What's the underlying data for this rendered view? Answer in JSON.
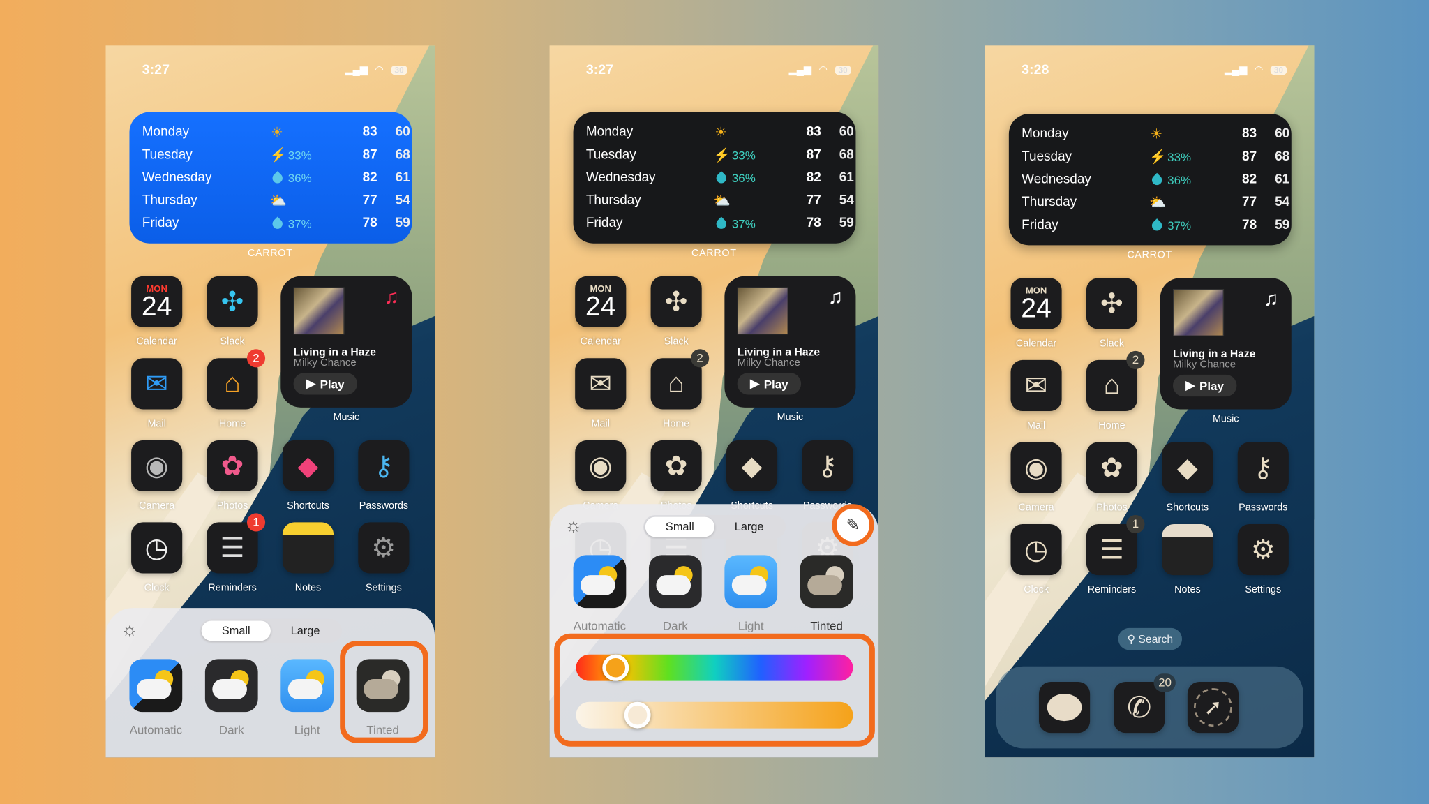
{
  "weather": {
    "source_label": "CARROT",
    "days": [
      {
        "day": "Monday",
        "icon": "sun-icon",
        "precip": "",
        "high": "83",
        "low": "60"
      },
      {
        "day": "Tuesday",
        "icon": "lightning-icon",
        "precip": "33%",
        "high": "87",
        "low": "68"
      },
      {
        "day": "Wednesday",
        "icon": "raindrop-icon",
        "precip": "36%",
        "high": "82",
        "low": "61"
      },
      {
        "day": "Thursday",
        "icon": "partly-cloudy-icon",
        "precip": "",
        "high": "77",
        "low": "54"
      },
      {
        "day": "Friday",
        "icon": "raindrop-icon",
        "precip": "37%",
        "high": "78",
        "low": "59"
      }
    ]
  },
  "calendar": {
    "weekday": "MON",
    "date": "24"
  },
  "music": {
    "song": "Living in a Haze",
    "artist": "Milky Chance",
    "play_label": "Play",
    "widget_label": "Music"
  },
  "apps": [
    {
      "name": "Calendar",
      "icon": "calendar-icon"
    },
    {
      "name": "Slack",
      "icon": "slack-icon"
    },
    {
      "name": "Mail",
      "icon": "mail-icon"
    },
    {
      "name": "Home",
      "icon": "home-icon",
      "badge": "2"
    },
    {
      "name": "Camera",
      "icon": "camera-icon"
    },
    {
      "name": "Photos",
      "icon": "photos-icon"
    },
    {
      "name": "Shortcuts",
      "icon": "shortcuts-icon"
    },
    {
      "name": "Passwords",
      "icon": "key-icon"
    },
    {
      "name": "Clock",
      "icon": "clock-icon"
    },
    {
      "name": "Reminders",
      "icon": "reminders-icon",
      "badge": "1"
    },
    {
      "name": "Notes",
      "icon": "notes-icon"
    },
    {
      "name": "Settings",
      "icon": "gear-icon"
    }
  ],
  "customize_sheet": {
    "sizes": [
      "Small",
      "Large"
    ],
    "selected_size": "Small",
    "styles": [
      "Automatic",
      "Dark",
      "Light",
      "Tinted"
    ],
    "selected_style": "Tinted",
    "hue_value": 0.14,
    "saturation_value": 0.22,
    "highlight_color": "#f26b1d"
  },
  "phones": [
    {
      "time": "3:27",
      "battery": "30",
      "mode": "dark",
      "sheet": "styles"
    },
    {
      "time": "3:27",
      "battery": "30",
      "mode": "tinted",
      "sheet": "tint"
    },
    {
      "time": "3:28",
      "battery": "30",
      "mode": "tinted",
      "sheet": "none"
    }
  ],
  "search_label": "Search",
  "dock": [
    {
      "name": "Messages",
      "icon": "messages-icon"
    },
    {
      "name": "Phone",
      "icon": "phone-icon",
      "badge": "20"
    },
    {
      "name": "Safari",
      "icon": "compass-icon"
    }
  ]
}
